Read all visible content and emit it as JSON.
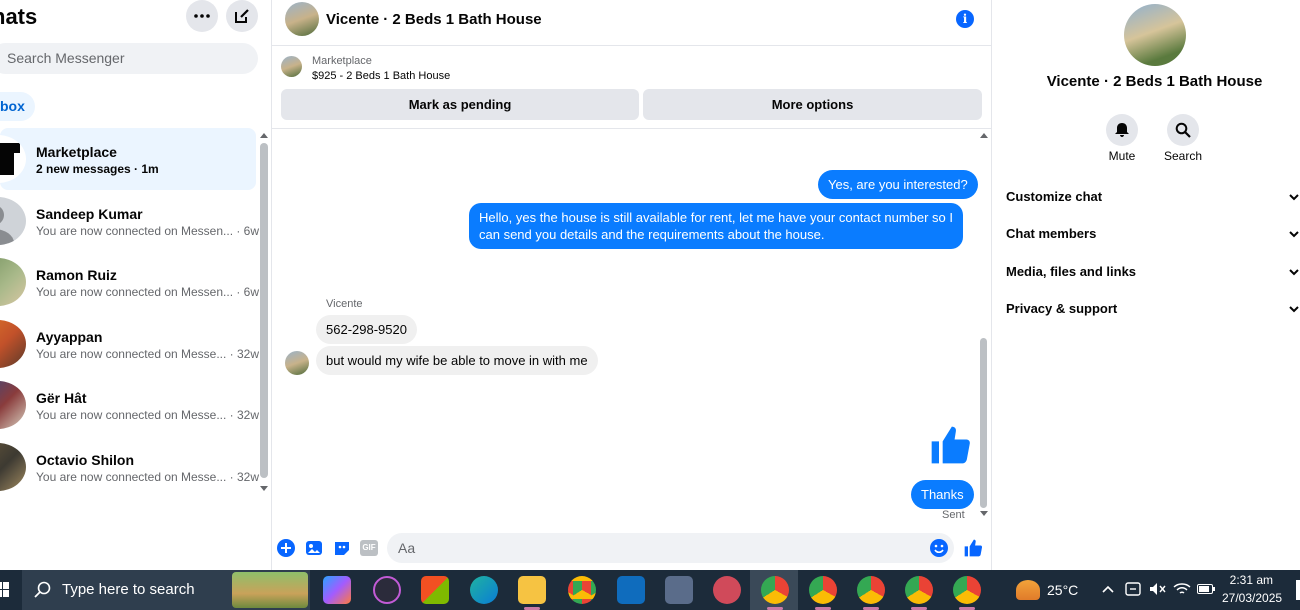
{
  "sidebar": {
    "title": "hats",
    "search_placeholder": "Search Messenger",
    "inbox_label": "box",
    "chats": [
      {
        "name": "Marketplace",
        "sub": "2 new messages · 1m",
        "active": true
      },
      {
        "name": "Sandeep Kumar",
        "sub": "You are now connected on Messen... · 6w"
      },
      {
        "name": "Ramon Ruiz",
        "sub": "You are now connected on Messen... · 6w"
      },
      {
        "name": "Ayyappan",
        "sub": "You are now connected on Messe... · 32w"
      },
      {
        "name": "Gër Hât",
        "sub": "You are now connected on Messe... · 32w"
      },
      {
        "name": "Octavio Shilon",
        "sub": "You are now connected on Messe... · 32w"
      }
    ]
  },
  "conversation": {
    "title": "Vicente · 2 Beds 1 Bath House",
    "marketplace_label": "Marketplace",
    "listing": "$925 - 2 Beds 1 Bath House",
    "mark_pending_label": "Mark as pending",
    "more_options_label": "More options",
    "messages": {
      "out1": "Yes, are you interested?",
      "out2_line1": "Hello, yes the house is still available for rent, let me have your contact number so I",
      "out2_line2": "can send you details and the requirements about the house.",
      "sender": "Vicente",
      "in1": "562-298-9520",
      "in2": "but would my wife be able to move in with me",
      "out3": "Thanks",
      "status": "Sent"
    },
    "composer_placeholder": "Aa",
    "gif_label": "GIF"
  },
  "info_panel": {
    "title": "Vicente · 2 Beds 1 Bath House",
    "mute_label": "Mute",
    "search_label": "Search",
    "sections": [
      "Customize chat",
      "Chat members",
      "Media, files and links",
      "Privacy & support"
    ]
  },
  "taskbar": {
    "search_placeholder": "Type here to search",
    "temperature": "25°C",
    "time": "2:31 am",
    "date": "27/03/2025"
  },
  "colors": {
    "accent": "#0866ff",
    "outgoing_bubble": "#0a7cff",
    "incoming_bubble": "#f0f0f0",
    "active_chat": "#ebf5ff",
    "taskbar": "#1c2b3a"
  }
}
